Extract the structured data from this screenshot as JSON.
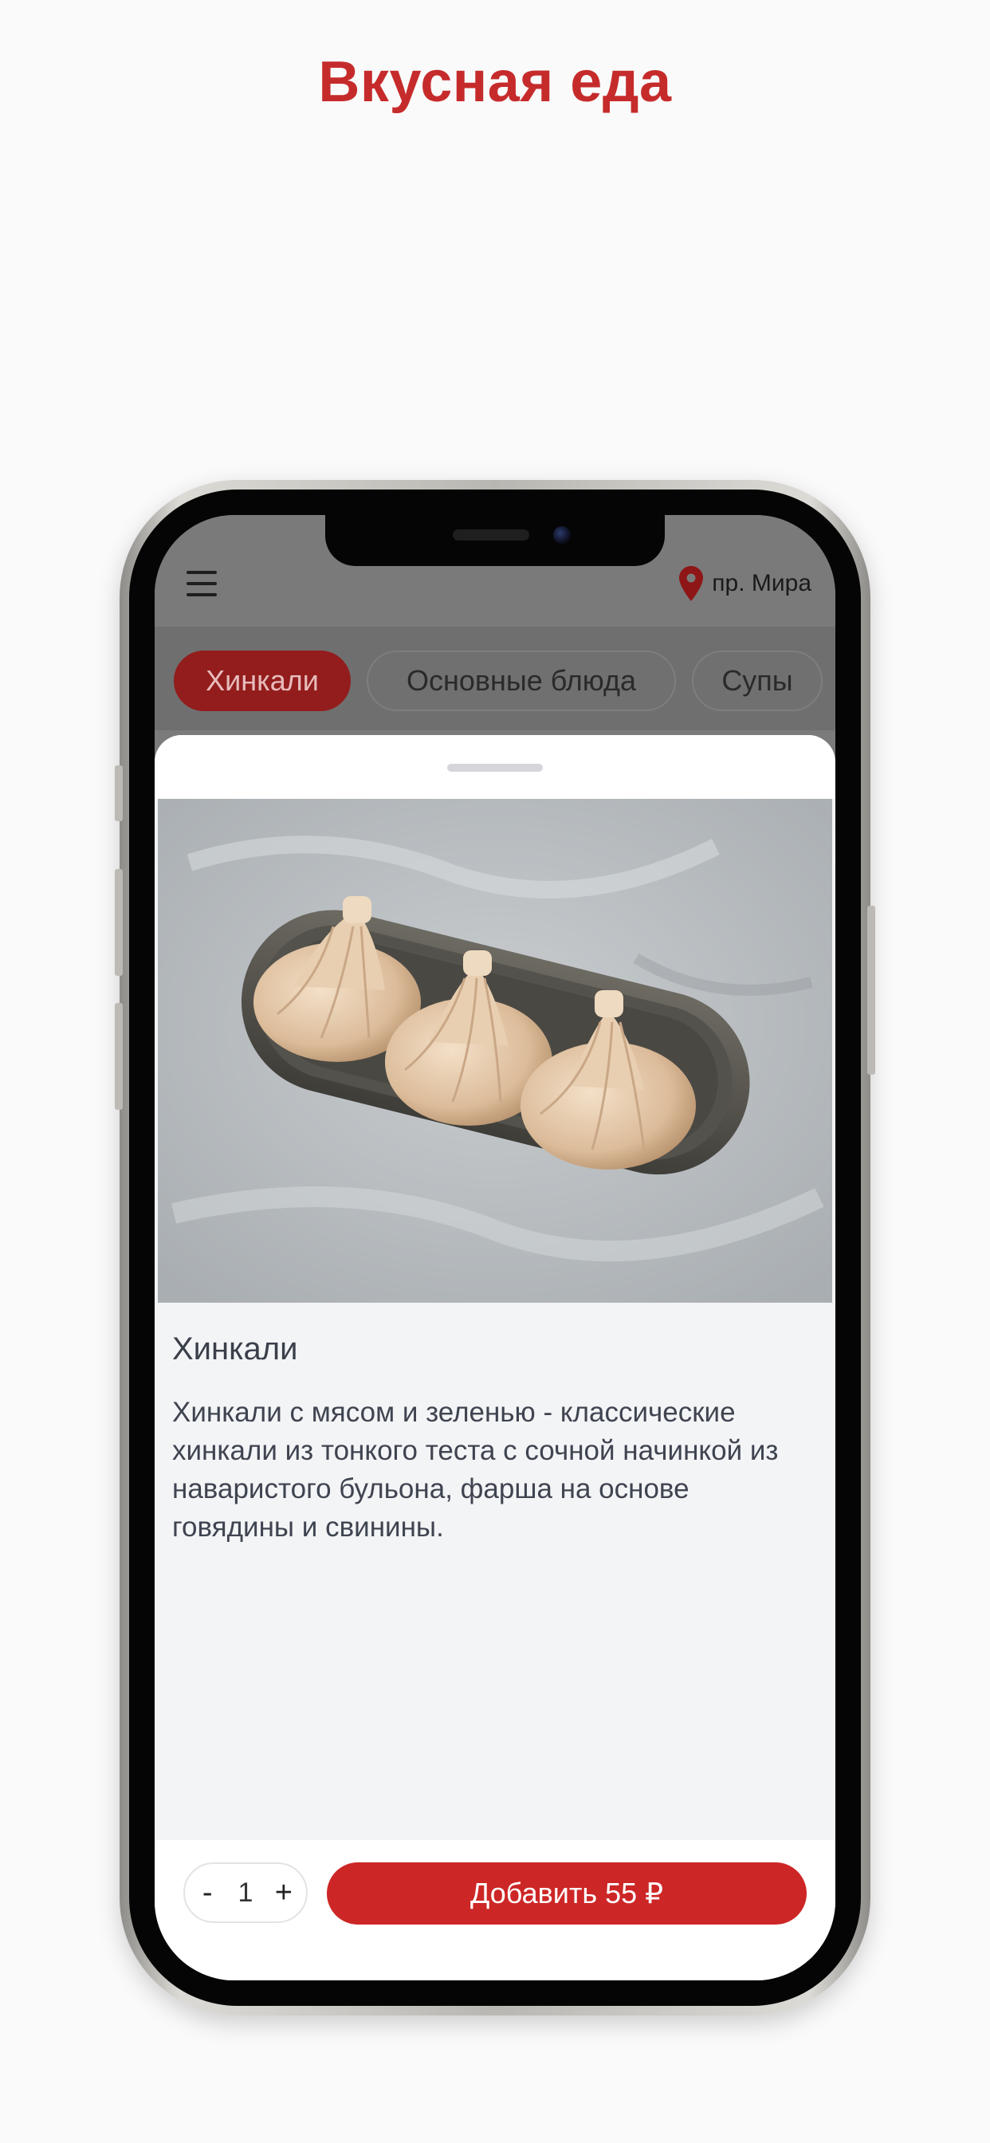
{
  "page": {
    "title": "Вкусная еда"
  },
  "header": {
    "menu_icon": "hamburger-menu-icon",
    "location_icon": "map-pin-icon",
    "location_label": "пр. Мира"
  },
  "categories": [
    {
      "label": "Хинкали",
      "active": true
    },
    {
      "label": "Основные блюда",
      "active": false
    },
    {
      "label": "Супы",
      "active": false
    }
  ],
  "product": {
    "name": "Хинкали",
    "description": "Хинкали с мясом и зеленью - классические хинкали из тонкого теста с сочной начинкой из наваристого бульона, фарша на основе говядины и свинины."
  },
  "footer": {
    "qty_minus": "-",
    "quantity": "1",
    "qty_plus": "+",
    "add_button_label": "Добавить 55 ₽"
  },
  "colors": {
    "accent": "#cd2626",
    "title": "#c62b2b",
    "overlay": "#7a7a7a",
    "sheet_bg": "#f3f4f6"
  }
}
